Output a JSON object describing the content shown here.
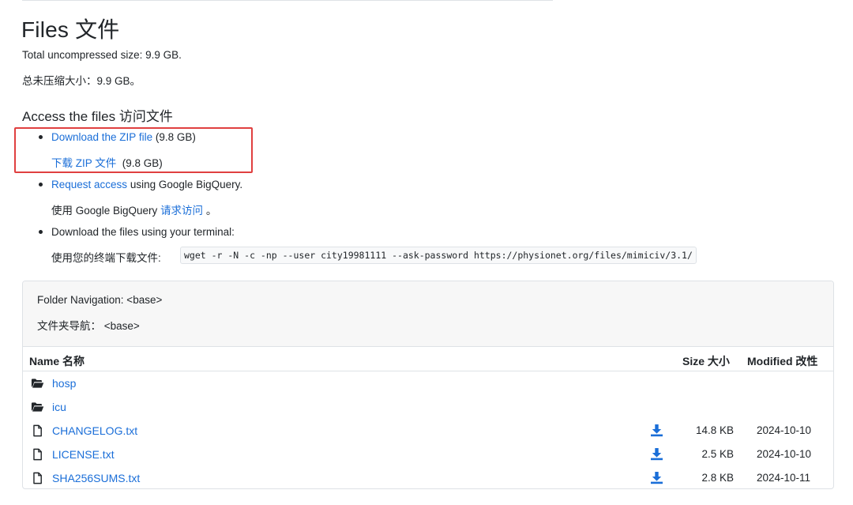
{
  "page": {
    "title": "Files  文件",
    "total_size_en": "Total uncompressed size: 9.9 GB.",
    "total_size_zh": "总未压缩大小：9.9 GB。"
  },
  "access": {
    "heading": "Access the files  访问文件",
    "zip": {
      "link_en": "Download the ZIP file",
      "size_en": " (9.8 GB)",
      "link_zh": "下载 ZIP 文件",
      "size_zh": "  (9.8 GB)"
    },
    "bigquery": {
      "link_en": "Request access",
      "text_en": " using Google BigQuery.",
      "prefix_zh": "使用 Google BigQuery ",
      "link_zh": "请求访问",
      "suffix_zh": " 。"
    },
    "terminal": {
      "text_en": "Download the files using your terminal:",
      "label_zh": "使用您的终端下载文件:",
      "command": "wget -r -N -c -np --user city19981111 --ask-password https://physionet.org/files/mimiciv/3.1/"
    }
  },
  "browser": {
    "folder_nav_en": "Folder Navigation:  <base>",
    "folder_nav_zh": "文件夹导航：  <base>",
    "columns": {
      "name": "Name  名称",
      "size": "Size  大小",
      "modified": "Modified  改性"
    },
    "rows": [
      {
        "type": "folder",
        "name": "hosp",
        "size": "",
        "modified": "",
        "icon": "folder-open-icon"
      },
      {
        "type": "folder",
        "name": "icu",
        "size": "",
        "modified": "",
        "icon": "folder-open-icon"
      },
      {
        "type": "file",
        "name": "CHANGELOG.txt",
        "size": "14.8 KB",
        "modified": "2024-10-10",
        "icon": "file-icon"
      },
      {
        "type": "file",
        "name": "LICENSE.txt",
        "size": "2.5 KB",
        "modified": "2024-10-10",
        "icon": "file-icon"
      },
      {
        "type": "file",
        "name": "SHA256SUMS.txt",
        "size": "2.8 KB",
        "modified": "2024-10-11",
        "icon": "file-icon"
      }
    ]
  },
  "colors": {
    "link": "#1a6ed8",
    "highlight_border": "#e04040",
    "panel_header_bg": "#f7f7f7"
  }
}
